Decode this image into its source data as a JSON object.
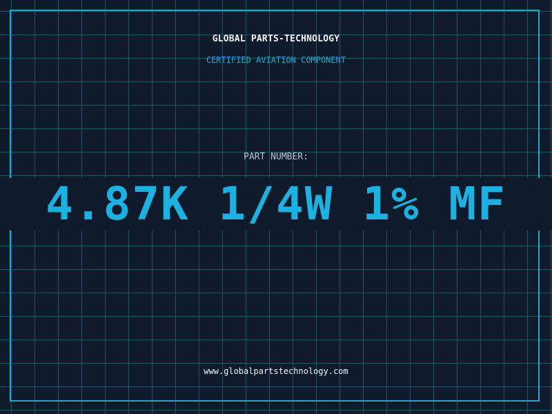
{
  "header": {
    "company": "GLOBAL PARTS-TECHNOLOGY",
    "subtitle": "CERTIFIED AVIATION COMPONENT"
  },
  "part": {
    "label": "PART NUMBER:",
    "number": "4.87K 1/4W 1% MF"
  },
  "footer": {
    "website": "www.globalpartstechnology.com"
  },
  "colors": {
    "background": "#0f1a2b",
    "grid": "#1d5468",
    "accent": "#1ab2e0",
    "text": "#f2f4f7"
  }
}
